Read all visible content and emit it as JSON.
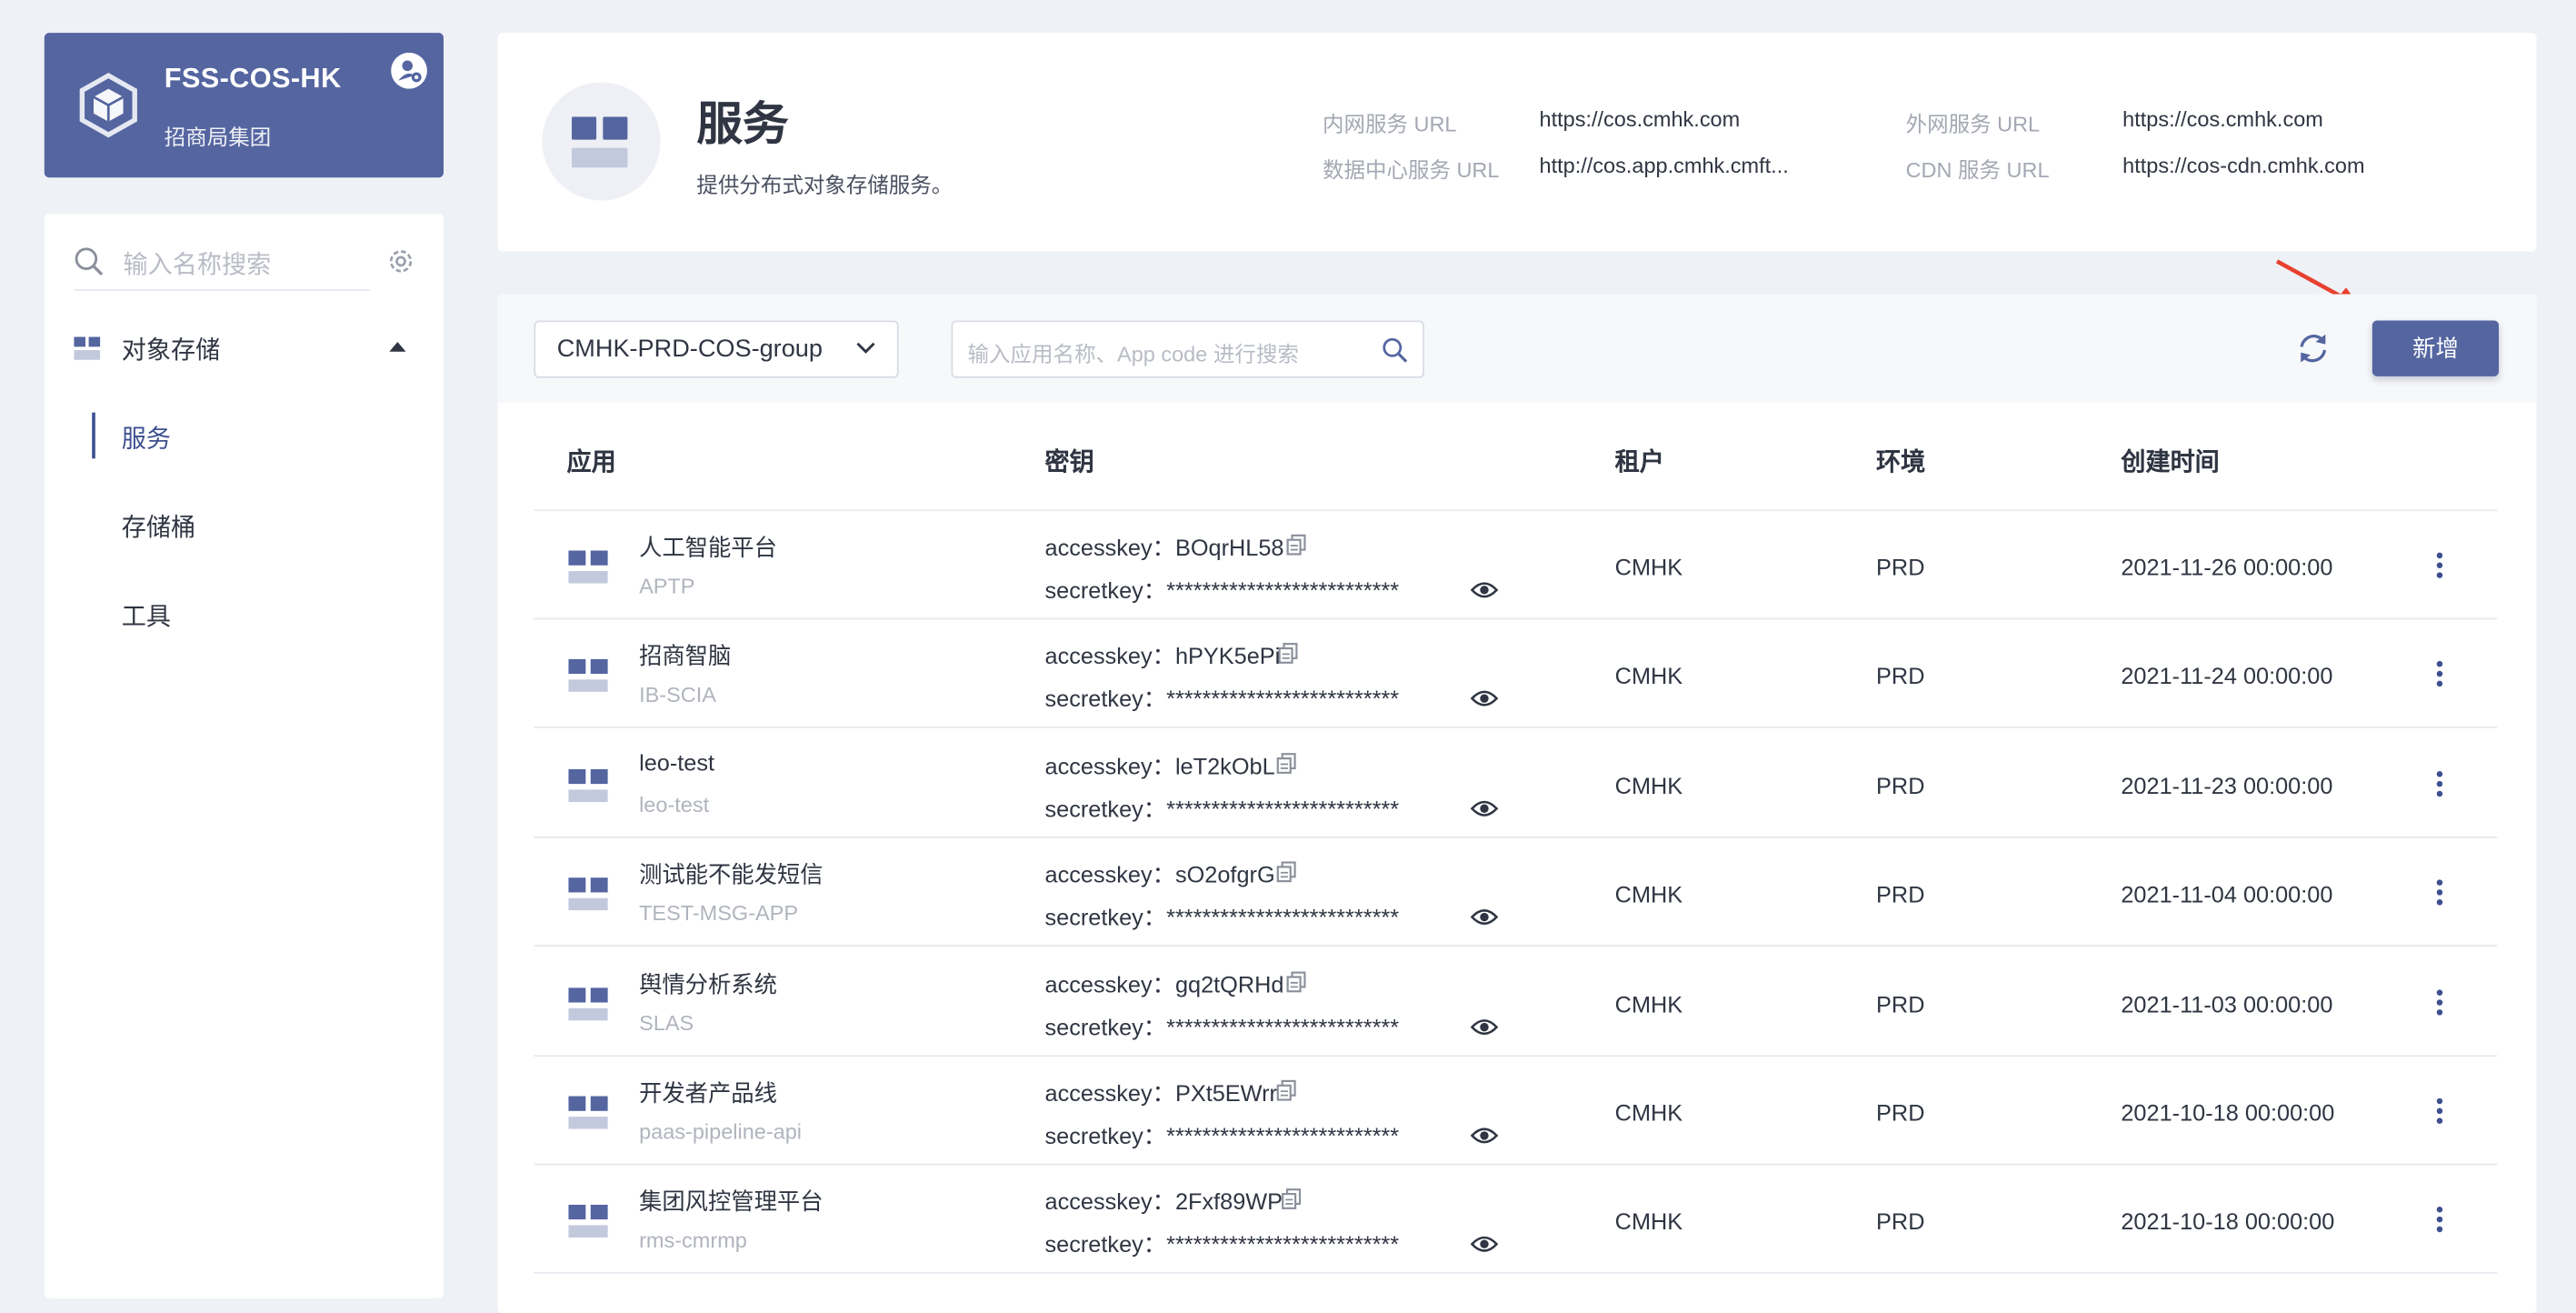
{
  "sidebar": {
    "brand_title": "FSS-COS-HK",
    "brand_subtitle": "招商局集团",
    "search_placeholder": "输入名称搜索",
    "group_label": "对象存储",
    "items": [
      {
        "label": "服务",
        "active": true
      },
      {
        "label": "存储桶",
        "active": false
      },
      {
        "label": "工具",
        "active": false
      }
    ]
  },
  "header": {
    "title": "服务",
    "description": "提供分布式对象存储服务。",
    "urls": [
      {
        "label": "内网服务 URL",
        "value": "https://cos.cmhk.com"
      },
      {
        "label": "数据中心服务 URL",
        "value": "http://cos.app.cmhk.cmft..."
      },
      {
        "label": "外网服务 URL",
        "value": "https://cos.cmhk.com"
      },
      {
        "label": "CDN 服务 URL",
        "value": "https://cos-cdn.cmhk.com"
      }
    ]
  },
  "toolbar": {
    "group_select_value": "CMHK-PRD-COS-group",
    "search_placeholder": "输入应用名称、App code 进行搜索",
    "add_label": "新增"
  },
  "table": {
    "columns": [
      "应用",
      "密钥",
      "租户",
      "环境",
      "创建时间"
    ],
    "rows": [
      {
        "name": "人工智能平台",
        "code": "APTP",
        "accesskey": "accesskey：BOqrHL58",
        "secretkey": "secretkey：**************************",
        "tenant": "CMHK",
        "env": "PRD",
        "created": "2021-11-26 00:00:00"
      },
      {
        "name": "招商智脑",
        "code": "IB-SCIA",
        "accesskey": "accesskey：hPYK5ePi",
        "secretkey": "secretkey：**************************",
        "tenant": "CMHK",
        "env": "PRD",
        "created": "2021-11-24 00:00:00"
      },
      {
        "name": "leo-test",
        "code": "leo-test",
        "accesskey": "accesskey：leT2kObL",
        "secretkey": "secretkey：**************************",
        "tenant": "CMHK",
        "env": "PRD",
        "created": "2021-11-23 00:00:00"
      },
      {
        "name": "测试能不能发短信",
        "code": "TEST-MSG-APP",
        "accesskey": "accesskey：sO2ofgrG",
        "secretkey": "secretkey：**************************",
        "tenant": "CMHK",
        "env": "PRD",
        "created": "2021-11-04 00:00:00"
      },
      {
        "name": "舆情分析系统",
        "code": "SLAS",
        "accesskey": "accesskey：gq2tQRHd",
        "secretkey": "secretkey：**************************",
        "tenant": "CMHK",
        "env": "PRD",
        "created": "2021-11-03 00:00:00"
      },
      {
        "name": "开发者产品线",
        "code": "paas-pipeline-api",
        "accesskey": "accesskey：PXt5EWrr",
        "secretkey": "secretkey：**************************",
        "tenant": "CMHK",
        "env": "PRD",
        "created": "2021-10-18 00:00:00"
      },
      {
        "name": "集团风控管理平台",
        "code": "rms-cmrmp",
        "accesskey": "accesskey：2Fxf89WP",
        "secretkey": "secretkey：**************************",
        "tenant": "CMHK",
        "env": "PRD",
        "created": "2021-10-18 00:00:00"
      }
    ]
  },
  "colors": {
    "brand": "#5465a0",
    "accent": "#3d4f8f",
    "background": "#eef1f6",
    "annotation_arrow": "#e8402f"
  },
  "icons": [
    "cube-logo-icon",
    "user-settings-icon",
    "search-icon",
    "gear-icon",
    "grid-icon",
    "caret-up-icon",
    "chevron-down-icon",
    "refresh-icon",
    "copy-icon",
    "eye-icon",
    "more-vertical-icon",
    "app-icon"
  ]
}
